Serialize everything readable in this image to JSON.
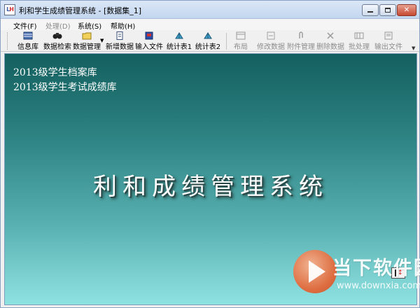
{
  "window": {
    "title": "利和学生成绩管理系统 - [数据集_1]",
    "logo_text_l": "L",
    "logo_text_h": "H"
  },
  "menu": {
    "items": [
      {
        "label": "文件(F)",
        "enabled": true
      },
      {
        "label": "处理(D)",
        "enabled": false
      },
      {
        "label": "系统(S)",
        "enabled": true
      },
      {
        "label": "帮助(H)",
        "enabled": true
      }
    ]
  },
  "toolbar": {
    "buttons": [
      {
        "label": "信息库",
        "icon": "database-icon",
        "enabled": true
      },
      {
        "label": "数据检索",
        "icon": "binoculars-icon",
        "enabled": true
      },
      {
        "label": "数据管理",
        "icon": "folder-icon",
        "enabled": true
      },
      {
        "label": "新增数据",
        "icon": "new-document-icon",
        "enabled": true
      },
      {
        "label": "输入文件",
        "icon": "import-file-icon",
        "enabled": true
      },
      {
        "label": "统计表1",
        "icon": "chart-tool-icon",
        "enabled": true
      },
      {
        "label": "统计表2",
        "icon": "chart-tool-icon",
        "enabled": true
      },
      {
        "label": "布局",
        "icon": "layout-icon",
        "enabled": false
      },
      {
        "label": "修改数据",
        "icon": "edit-data-icon",
        "enabled": false
      },
      {
        "label": "附件管理",
        "icon": "paperclip-icon",
        "enabled": false
      },
      {
        "label": "删除数据",
        "icon": "delete-icon",
        "enabled": false
      },
      {
        "label": "批处理",
        "icon": "batch-icon",
        "enabled": false
      },
      {
        "label": "输出文件",
        "icon": "export-file-icon",
        "enabled": false
      }
    ]
  },
  "main": {
    "databases": [
      "2013级学生档案库",
      "2013级学生考试成绩库"
    ],
    "app_title": "利和成绩管理系统"
  },
  "watermark": {
    "name": "当下软件园",
    "url": "www.downxia.com"
  },
  "colors": {
    "client_top": "#145f5f",
    "client_bottom": "#8fe2e2",
    "watermark_orange": "#e8602f"
  }
}
